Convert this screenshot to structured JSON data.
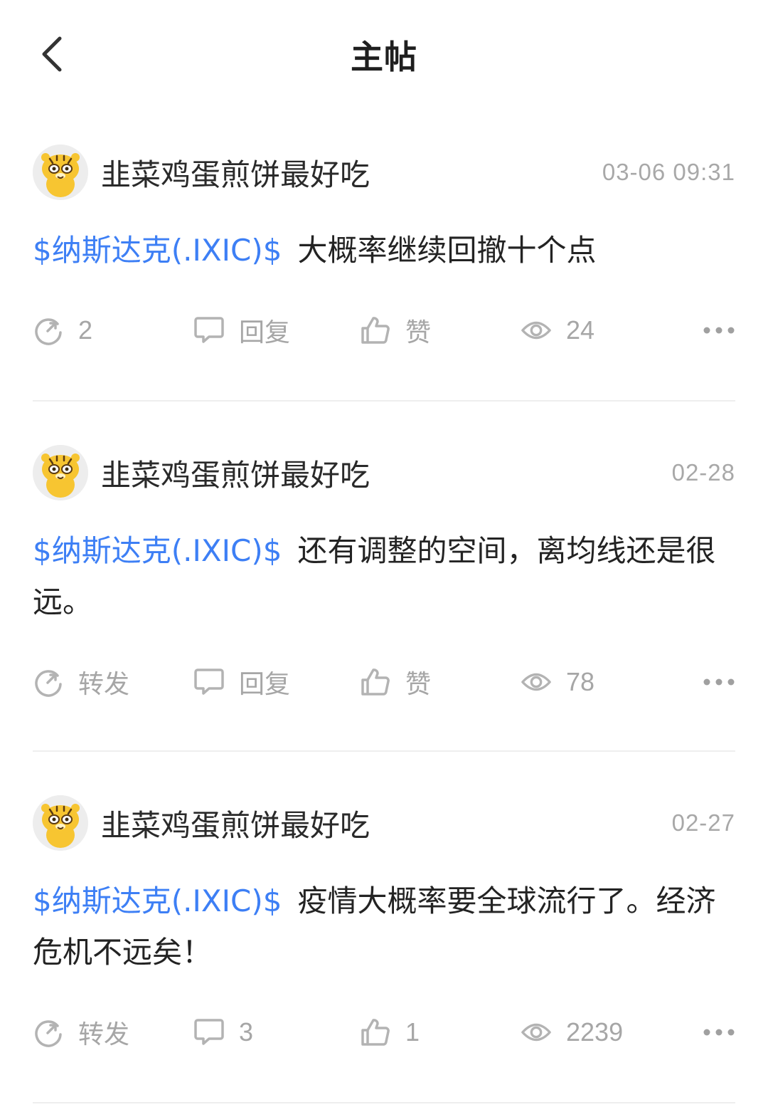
{
  "header": {
    "title": "主帖"
  },
  "posts": [
    {
      "author": "韭菜鸡蛋煎饼最好吃",
      "time": "03-06 09:31",
      "ticker": "$纳斯达克(.IXIC)$",
      "text": "大概率继续回撤十个点",
      "share": "2",
      "reply": "回复",
      "like": "赞",
      "views": "24"
    },
    {
      "author": "韭菜鸡蛋煎饼最好吃",
      "time": "02-28",
      "ticker": "$纳斯达克(.IXIC)$",
      "text": "还有调整的空间，离均线还是很远。",
      "share": "转发",
      "reply": "回复",
      "like": "赞",
      "views": "78"
    },
    {
      "author": "韭菜鸡蛋煎饼最好吃",
      "time": "02-27",
      "ticker": "$纳斯达克(.IXIC)$",
      "text": "疫情大概率要全球流行了。经济危机不远矣！",
      "share": "转发",
      "reply": "3",
      "like": "1",
      "views": "2239"
    }
  ],
  "icons": {
    "back": "chevron-left-icon",
    "share": "share-arrow-icon",
    "reply": "comment-icon",
    "like": "thumbs-up-icon",
    "views": "eye-icon",
    "more": "more-dots-icon"
  },
  "colors": {
    "ticker": "#3d7ff5",
    "muted": "#a6a6a6",
    "divider": "#eeeeee",
    "avatar_yellow": "#f7c531"
  }
}
